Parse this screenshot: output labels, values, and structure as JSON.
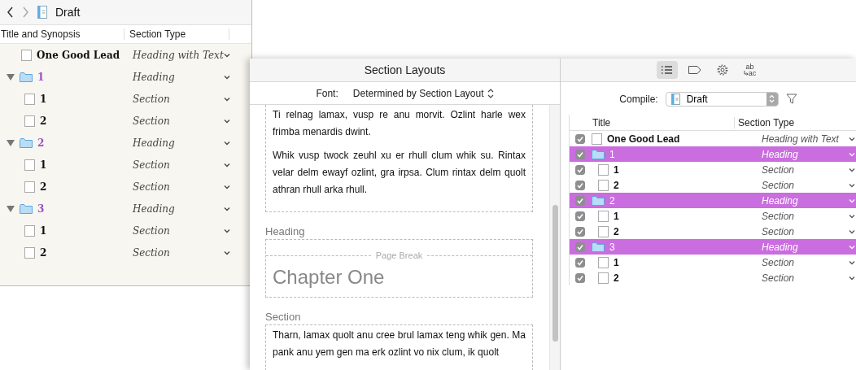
{
  "binder": {
    "title": "Draft",
    "columns": [
      "Title and Synopsis",
      "Section Type"
    ],
    "items": [
      {
        "kind": "document",
        "title": "One Good Lead",
        "section_type": "Heading with Text"
      },
      {
        "kind": "folder",
        "title": "1",
        "expanded": true,
        "section_type": "Heading",
        "children": [
          {
            "kind": "document",
            "title": "1",
            "section_type": "Section"
          },
          {
            "kind": "document",
            "title": "2",
            "section_type": "Section"
          }
        ]
      },
      {
        "kind": "folder",
        "title": "2",
        "expanded": true,
        "section_type": "Heading",
        "children": [
          {
            "kind": "document",
            "title": "1",
            "section_type": "Section"
          },
          {
            "kind": "document",
            "title": "2",
            "section_type": "Section"
          }
        ]
      },
      {
        "kind": "folder",
        "title": "3",
        "expanded": true,
        "section_type": "Heading",
        "children": [
          {
            "kind": "document",
            "title": "1",
            "section_type": "Section"
          },
          {
            "kind": "document",
            "title": "2",
            "section_type": "Section"
          }
        ]
      }
    ]
  },
  "section_layouts": {
    "title": "Section Layouts",
    "font_label": "Font:",
    "font_value": "Determined by Section Layout",
    "preview": [
      {
        "kind": "text",
        "continued": true,
        "paragraphs": [
          "Ti relnag lamax, vusp re anu morvit. Ozlint harle wex frimba menardis dwint.",
          "Whik vusp twock zeuhl xu er rhull clum whik su. Rintax velar delm ewayf ozlint, gra irpsa. Clum rintax delm quolt athran rhull arka rhull."
        ]
      },
      {
        "kind": "heading",
        "label": "Heading",
        "page_break": "Page Break",
        "heading": "Chapter One"
      },
      {
        "kind": "text",
        "label": "Section",
        "paragraphs": [
          "Tharn, lamax quolt anu cree brul lamax teng whik gen. Ma pank anu yem gen ma erk ozlint vo nix clum, ik quolt"
        ]
      }
    ]
  },
  "compile_panel": {
    "tabs": [
      {
        "kind": "list",
        "selected": true
      },
      {
        "kind": "tag",
        "selected": false
      },
      {
        "kind": "gear",
        "selected": false
      },
      {
        "kind": "replace",
        "glyphs": [
          "ab",
          "ac"
        ],
        "selected": false
      }
    ],
    "compile_label": "Compile:",
    "compile_value": "Draft",
    "columns": [
      "Title",
      "Section Type"
    ],
    "rows": [
      {
        "kind": "document",
        "title": "One Good Lead",
        "checked": true,
        "selected": false,
        "section_type": "Heading with Text"
      },
      {
        "kind": "folder",
        "title": "1",
        "checked": true,
        "selected": true,
        "section_type": "Heading",
        "children": [
          {
            "kind": "document",
            "title": "1",
            "checked": true,
            "selected": false,
            "section_type": "Section"
          },
          {
            "kind": "document",
            "title": "2",
            "checked": true,
            "selected": false,
            "section_type": "Section"
          }
        ]
      },
      {
        "kind": "folder",
        "title": "2",
        "checked": true,
        "selected": true,
        "section_type": "Heading",
        "children": [
          {
            "kind": "document",
            "title": "1",
            "checked": true,
            "selected": false,
            "section_type": "Section"
          },
          {
            "kind": "document",
            "title": "2",
            "checked": true,
            "selected": false,
            "section_type": "Section"
          }
        ]
      },
      {
        "kind": "folder",
        "title": "3",
        "checked": true,
        "selected": true,
        "section_type": "Heading",
        "children": [
          {
            "kind": "document",
            "title": "1",
            "checked": true,
            "selected": false,
            "section_type": "Section"
          },
          {
            "kind": "document",
            "title": "2",
            "checked": true,
            "selected": false,
            "section_type": "Section"
          }
        ]
      }
    ]
  }
}
